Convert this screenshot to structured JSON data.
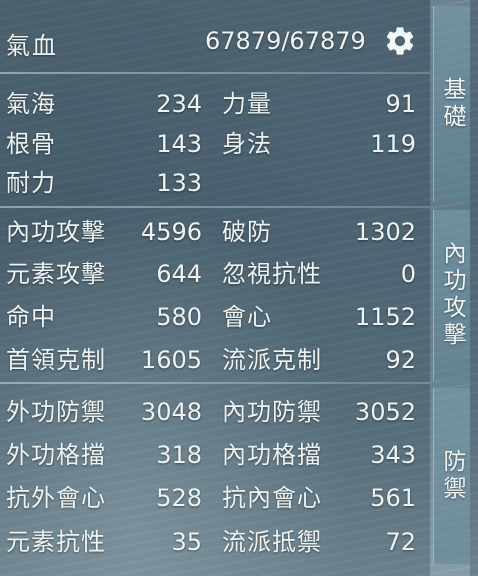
{
  "hp": {
    "label": "氣血",
    "value": "67879/67879"
  },
  "basic": [
    {
      "label": "氣海",
      "value": "234"
    },
    {
      "label": "力量",
      "value": "91"
    },
    {
      "label": "根骨",
      "value": "143"
    },
    {
      "label": "身法",
      "value": "119"
    },
    {
      "label": "耐力",
      "value": "133"
    }
  ],
  "attack": [
    {
      "label": "內功攻擊",
      "value": "4596"
    },
    {
      "label": "破防",
      "value": "1302"
    },
    {
      "label": "元素攻擊",
      "value": "644"
    },
    {
      "label": "忽視抗性",
      "value": "0"
    },
    {
      "label": "命中",
      "value": "580"
    },
    {
      "label": "會心",
      "value": "1152"
    },
    {
      "label": "首領克制",
      "value": "1605"
    },
    {
      "label": "流派克制",
      "value": "92"
    }
  ],
  "defense": [
    {
      "label": "外功防禦",
      "value": "3048"
    },
    {
      "label": "內功防禦",
      "value": "3052"
    },
    {
      "label": "外功格擋",
      "value": "318"
    },
    {
      "label": "內功格擋",
      "value": "343"
    },
    {
      "label": "抗外會心",
      "value": "528"
    },
    {
      "label": "抗內會心",
      "value": "561"
    },
    {
      "label": "元素抗性",
      "value": "35"
    },
    {
      "label": "流派抵禦",
      "value": "72"
    }
  ],
  "tabs": {
    "basic": "基礎",
    "attack": "內功攻擊",
    "defense": "防禦"
  },
  "icons": {
    "settings": "gear-icon"
  }
}
